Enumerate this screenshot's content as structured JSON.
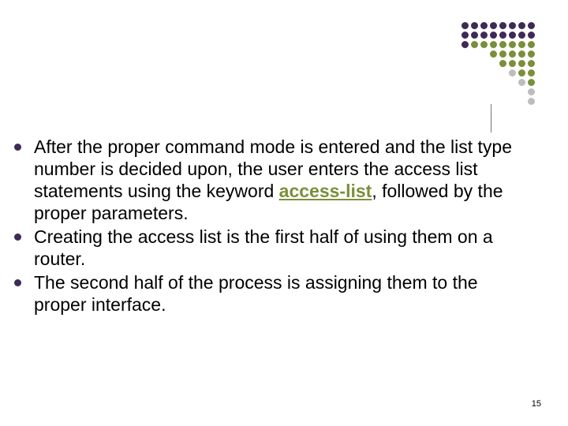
{
  "decor": {
    "colors": {
      "purple": "#3f2a56",
      "olive": "#7a8f3a",
      "grey": "#bdbdbd"
    },
    "rows": [
      [
        "purple",
        "purple",
        "purple",
        "purple",
        "purple",
        "purple",
        "purple",
        "purple"
      ],
      [
        "purple",
        "purple",
        "purple",
        "purple",
        "purple",
        "purple",
        "purple",
        "purple"
      ],
      [
        "purple",
        "olive",
        "olive",
        "olive",
        "olive",
        "olive",
        "olive",
        "olive"
      ],
      [
        "olive",
        "olive",
        "olive",
        "olive",
        "olive"
      ],
      [
        "olive",
        "olive",
        "olive",
        "olive"
      ],
      [
        "grey",
        "olive",
        "olive"
      ],
      [
        "grey",
        "olive"
      ],
      [
        "grey"
      ],
      [
        "grey"
      ]
    ]
  },
  "bullets": [
    {
      "pre": "After the proper command mode is entered and the list type number is decided upon, the user enters the access list statements using the keyword ",
      "keyword": "access-list",
      "post": ", followed by the proper parameters."
    },
    {
      "pre": "Creating the access list is the first half of using them on a router.",
      "keyword": "",
      "post": ""
    },
    {
      "pre": "The second half of the process is assigning them to the proper interface.",
      "keyword": "",
      "post": ""
    }
  ],
  "page_number": "15"
}
